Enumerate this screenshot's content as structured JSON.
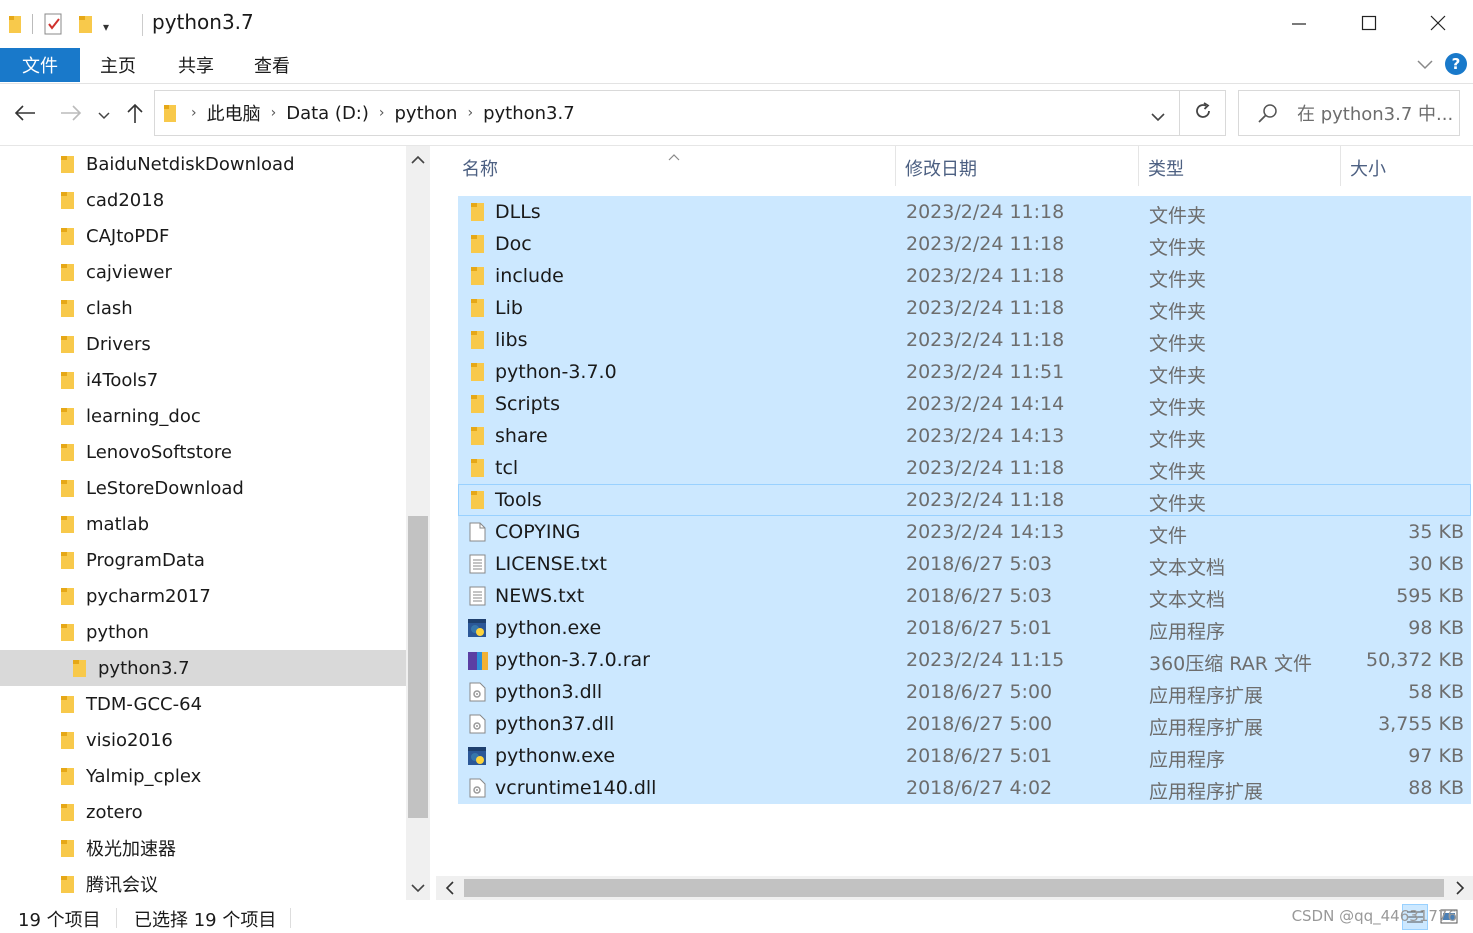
{
  "window": {
    "title": "python3.7",
    "minimize_icon": "minimize-icon",
    "maximize_icon": "maximize-icon",
    "close_icon": "close-icon"
  },
  "ribbon": {
    "tabs": [
      "文件",
      "主页",
      "共享",
      "查看"
    ],
    "help": "?"
  },
  "address": {
    "crumbs": [
      "此电脑",
      "Data (D:)",
      "python",
      "python3.7"
    ],
    "search_placeholder": "在 python3.7 中..."
  },
  "nav_tree": [
    "BaiduNetdiskDownload",
    "cad2018",
    "CAJtoPDF",
    "cajviewer",
    "clash",
    "Drivers",
    "i4Tools7",
    "learning_doc",
    "LenovoSoftstore",
    "LeStoreDownload",
    "matlab",
    "ProgramData",
    "pycharm2017",
    "python",
    "python3.7",
    "TDM-GCC-64",
    "visio2016",
    "Yalmip_cplex",
    "zotero",
    "极光加速器",
    "腾讯会议"
  ],
  "nav_selected": "python3.7",
  "columns": {
    "name": "名称",
    "date": "修改日期",
    "type": "类型",
    "size": "大小"
  },
  "files": [
    {
      "name": "DLLs",
      "date": "2023/2/24 11:18",
      "type": "文件夹",
      "size": "",
      "icon": "folder-icon"
    },
    {
      "name": "Doc",
      "date": "2023/2/24 11:18",
      "type": "文件夹",
      "size": "",
      "icon": "folder-icon"
    },
    {
      "name": "include",
      "date": "2023/2/24 11:18",
      "type": "文件夹",
      "size": "",
      "icon": "folder-icon"
    },
    {
      "name": "Lib",
      "date": "2023/2/24 11:18",
      "type": "文件夹",
      "size": "",
      "icon": "folder-icon"
    },
    {
      "name": "libs",
      "date": "2023/2/24 11:18",
      "type": "文件夹",
      "size": "",
      "icon": "folder-icon"
    },
    {
      "name": "python-3.7.0",
      "date": "2023/2/24 11:51",
      "type": "文件夹",
      "size": "",
      "icon": "folder-icon"
    },
    {
      "name": "Scripts",
      "date": "2023/2/24 14:14",
      "type": "文件夹",
      "size": "",
      "icon": "folder-icon"
    },
    {
      "name": "share",
      "date": "2023/2/24 14:13",
      "type": "文件夹",
      "size": "",
      "icon": "folder-icon"
    },
    {
      "name": "tcl",
      "date": "2023/2/24 11:18",
      "type": "文件夹",
      "size": "",
      "icon": "folder-icon"
    },
    {
      "name": "Tools",
      "date": "2023/2/24 11:18",
      "type": "文件夹",
      "size": "",
      "icon": "folder-icon"
    },
    {
      "name": "COPYING",
      "date": "2023/2/24 14:13",
      "type": "文件",
      "size": "35 KB",
      "icon": "file-icon"
    },
    {
      "name": "LICENSE.txt",
      "date": "2018/6/27 5:03",
      "type": "文本文档",
      "size": "30 KB",
      "icon": "text-file-icon"
    },
    {
      "name": "NEWS.txt",
      "date": "2018/6/27 5:03",
      "type": "文本文档",
      "size": "595 KB",
      "icon": "text-file-icon"
    },
    {
      "name": "python.exe",
      "date": "2018/6/27 5:01",
      "type": "应用程序",
      "size": "98 KB",
      "icon": "python-exe-icon"
    },
    {
      "name": "python-3.7.0.rar",
      "date": "2023/2/24 11:15",
      "type": "360压缩 RAR 文件",
      "size": "50,372 KB",
      "icon": "rar-icon"
    },
    {
      "name": "python3.dll",
      "date": "2018/6/27 5:00",
      "type": "应用程序扩展",
      "size": "58 KB",
      "icon": "dll-icon"
    },
    {
      "name": "python37.dll",
      "date": "2018/6/27 5:00",
      "type": "应用程序扩展",
      "size": "3,755 KB",
      "icon": "dll-icon"
    },
    {
      "name": "pythonw.exe",
      "date": "2018/6/27 5:01",
      "type": "应用程序",
      "size": "97 KB",
      "icon": "python-exe-icon"
    },
    {
      "name": "vcruntime140.dll",
      "date": "2018/6/27 4:02",
      "type": "应用程序扩展",
      "size": "88 KB",
      "icon": "dll-icon"
    }
  ],
  "status": {
    "count": "19 个项目",
    "selected": "已选择 19 个项目",
    "watermark": "CSDN @qq_44631776"
  },
  "colors": {
    "accent": "#1979ca",
    "selection": "#cce8ff",
    "folder": "#f8c94b"
  }
}
